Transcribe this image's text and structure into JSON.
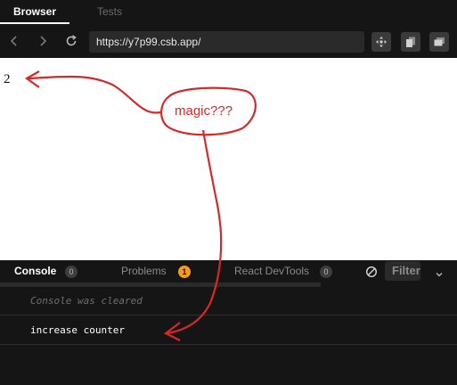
{
  "tabs": {
    "browser": "Browser",
    "tests": "Tests"
  },
  "navbar": {
    "url": "https://y7p99.csb.app/",
    "icons": [
      "back-arrow-icon",
      "forward-arrow-icon",
      "refresh-icon",
      "move-icon",
      "copy-icon",
      "open-new-window-icon"
    ]
  },
  "preview": {
    "counter_value": "2"
  },
  "console": {
    "tabs": [
      {
        "label": "Console",
        "badge": "0"
      },
      {
        "label": "Problems",
        "badge": "1"
      },
      {
        "label": "React DevTools",
        "badge": "0"
      }
    ],
    "filter_placeholder": "Filter",
    "messages": {
      "cleared": "Console was cleared",
      "log": "increase counter"
    }
  },
  "annotation": {
    "text": "magic???",
    "color": "#d62828"
  },
  "colors": {
    "problems_badge": "#f59a1e",
    "background": "#151515",
    "preview_background": "#ffffff"
  }
}
